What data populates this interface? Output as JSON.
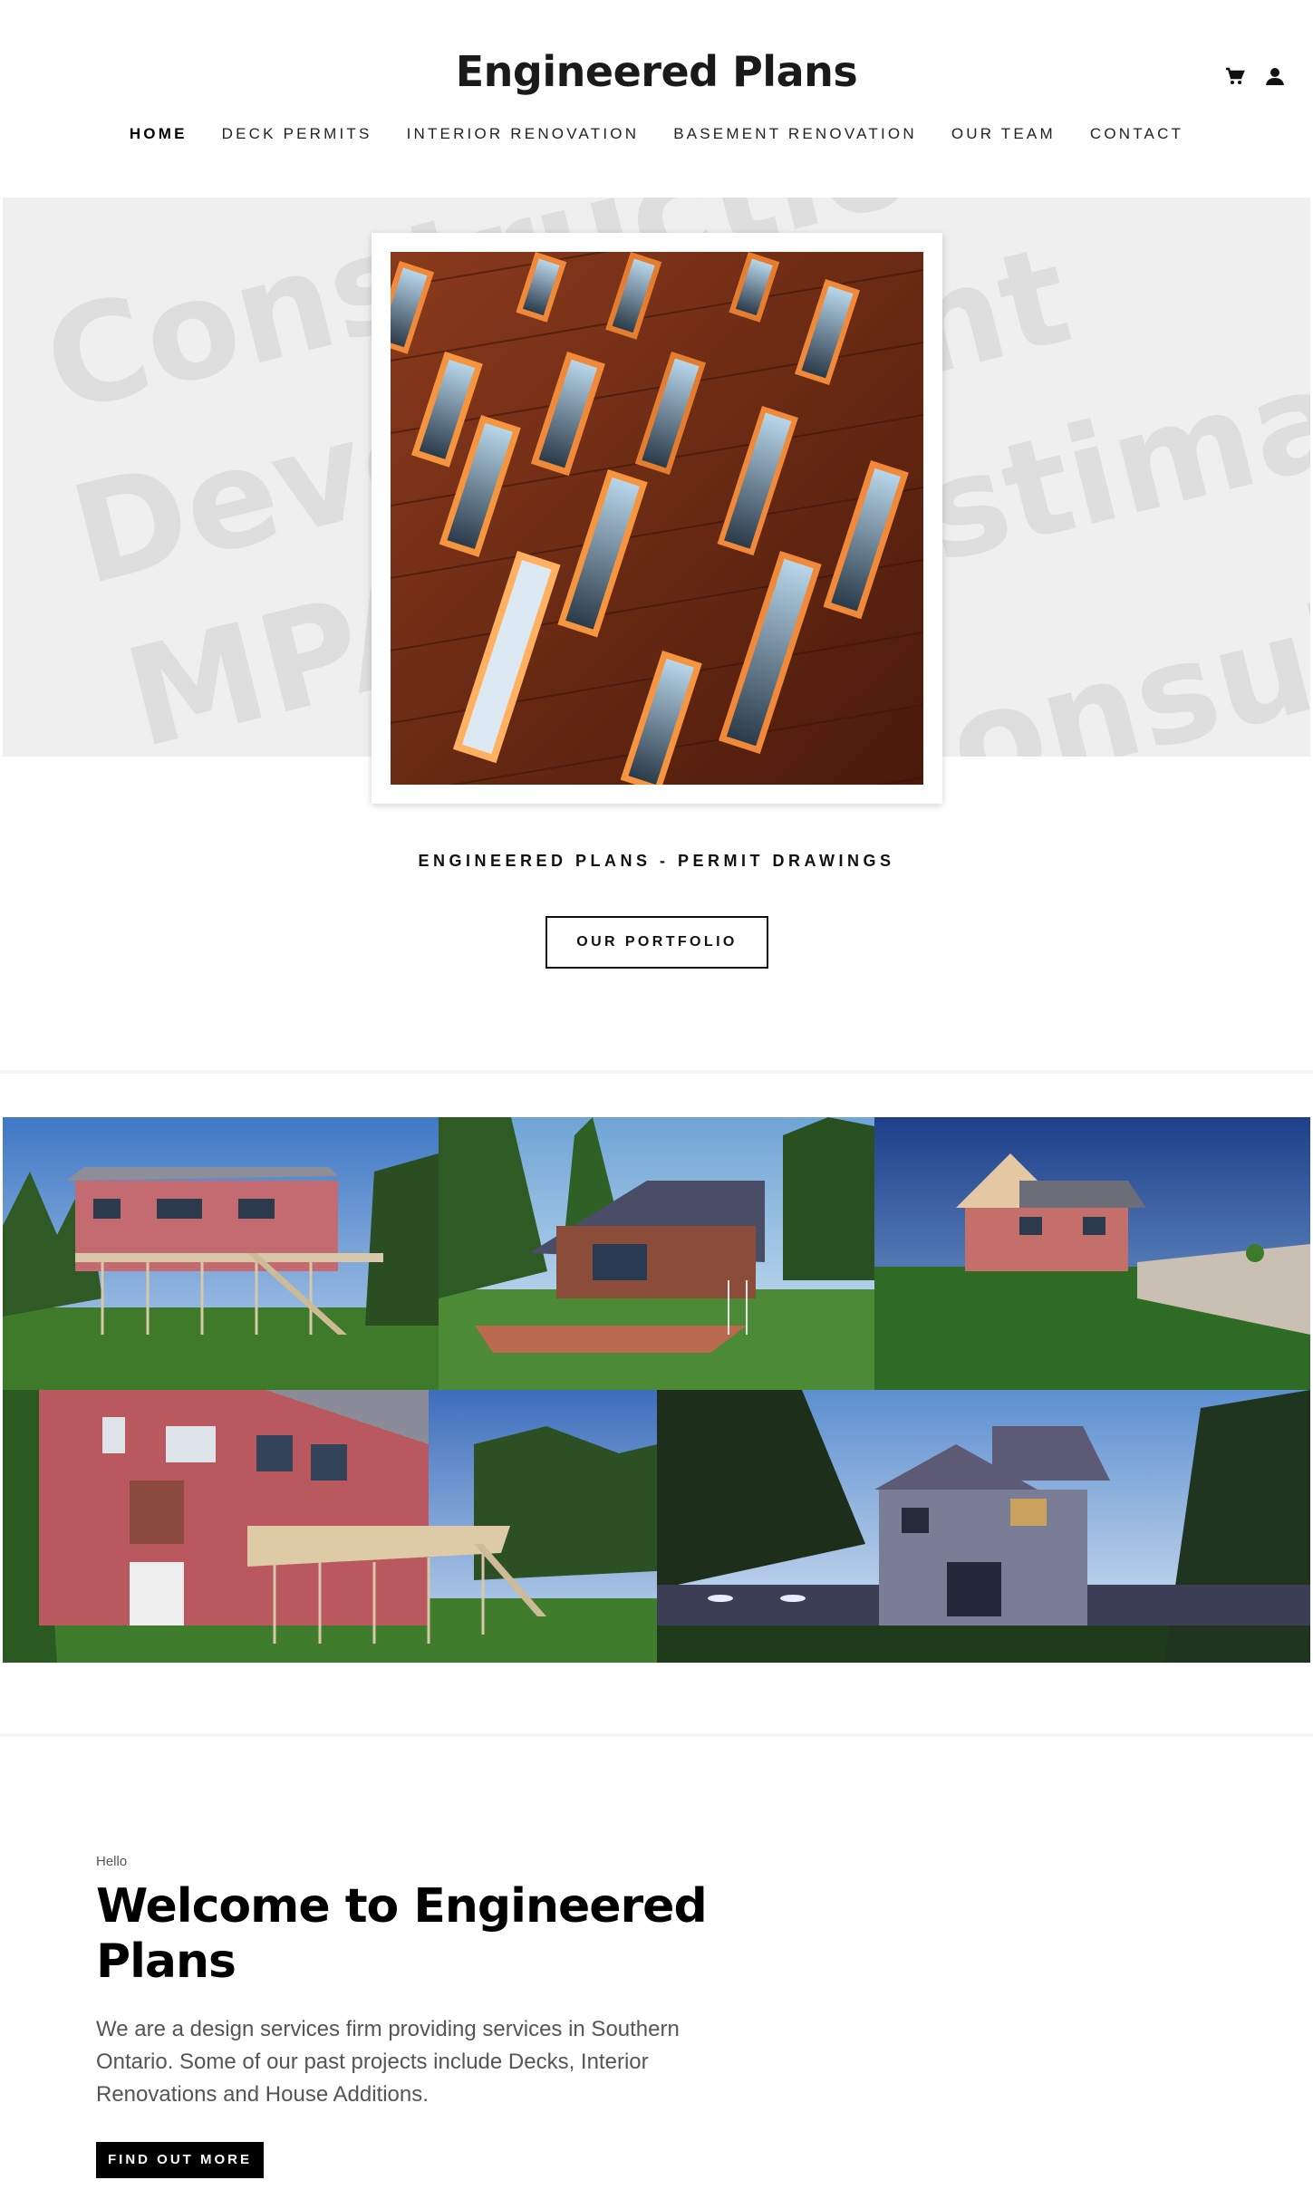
{
  "header": {
    "title": "Engineered Plans",
    "icons": [
      "cart-icon",
      "account-icon"
    ]
  },
  "nav": {
    "items": [
      {
        "label": "HOME",
        "active": true
      },
      {
        "label": "DECK PERMITS",
        "active": false
      },
      {
        "label": "INTERIOR RENOVATION",
        "active": false
      },
      {
        "label": "BASEMENT RENOVATION",
        "active": false
      },
      {
        "label": "OUR TEAM",
        "active": false
      },
      {
        "label": "CONTACT",
        "active": false
      }
    ]
  },
  "hero": {
    "background_words": [
      "Construction",
      "Development",
      "Estimate",
      "MPAC",
      "Consultation"
    ],
    "caption": "ENGINEERED PLANS - PERMIT DRAWINGS",
    "button_label": "OUR PORTFOLIO"
  },
  "gallery": {
    "images": [
      "deck-render-1",
      "cabin-render",
      "bungalow-render",
      "deck-render-2",
      "house-night-render"
    ]
  },
  "welcome": {
    "kicker": "Hello",
    "title": "Welcome to Engineered Plans",
    "text": "We are a design services firm providing services in Southern Ontario. Some of our past projects include Decks, Interior Renovations and House Additions.",
    "button_label": "FIND OUT MORE"
  },
  "colors": {
    "text": "#111111",
    "hero_bg": "#efefef",
    "watermark": "#dedede",
    "button_dark": "#000000"
  }
}
